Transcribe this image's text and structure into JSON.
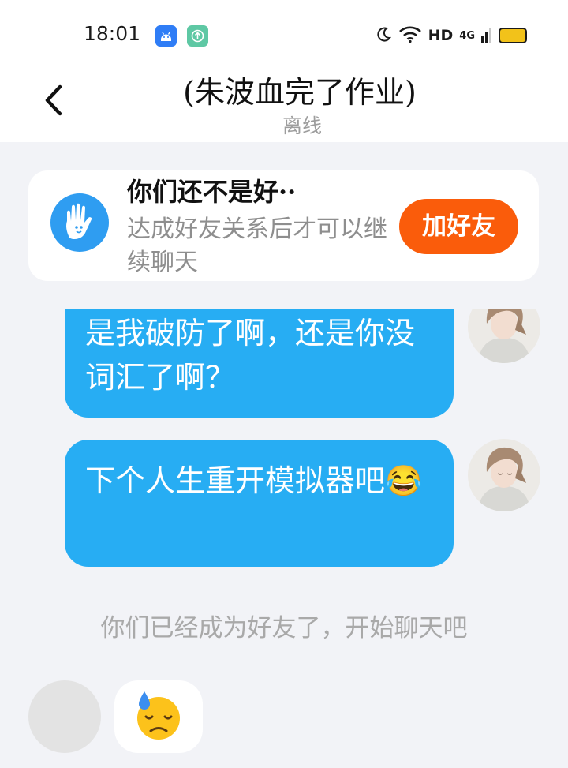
{
  "status_bar": {
    "time": "18:01",
    "hd_label": "HD",
    "network_label": "4G",
    "icons": [
      "android-icon",
      "update-icon",
      "moon-icon",
      "wifi-icon",
      "signal-icon",
      "battery-icon"
    ]
  },
  "header": {
    "title": "(朱波血完了作业)",
    "status": "离线",
    "back_icon": "chevron-left-icon"
  },
  "banner": {
    "title": "你们还不是好··",
    "text": "达成好友关系后才可以继续聊天",
    "button_label": "加好友",
    "icon": "hand-wave-icon"
  },
  "messages": [
    {
      "sender": "me",
      "text": "是我破防了啊，还是你没词汇了啊？"
    },
    {
      "sender": "me",
      "text": "下个人生重开模拟器吧😂"
    },
    {
      "sender": "other",
      "text": "😓"
    }
  ],
  "system_message": "你们已经成为好友了，开始聊天吧",
  "colors": {
    "accent_blue": "#27adf3",
    "add_friend_orange": "#fa5c0b",
    "background": "#f2f3f7",
    "muted_text": "#a9a9a9"
  }
}
